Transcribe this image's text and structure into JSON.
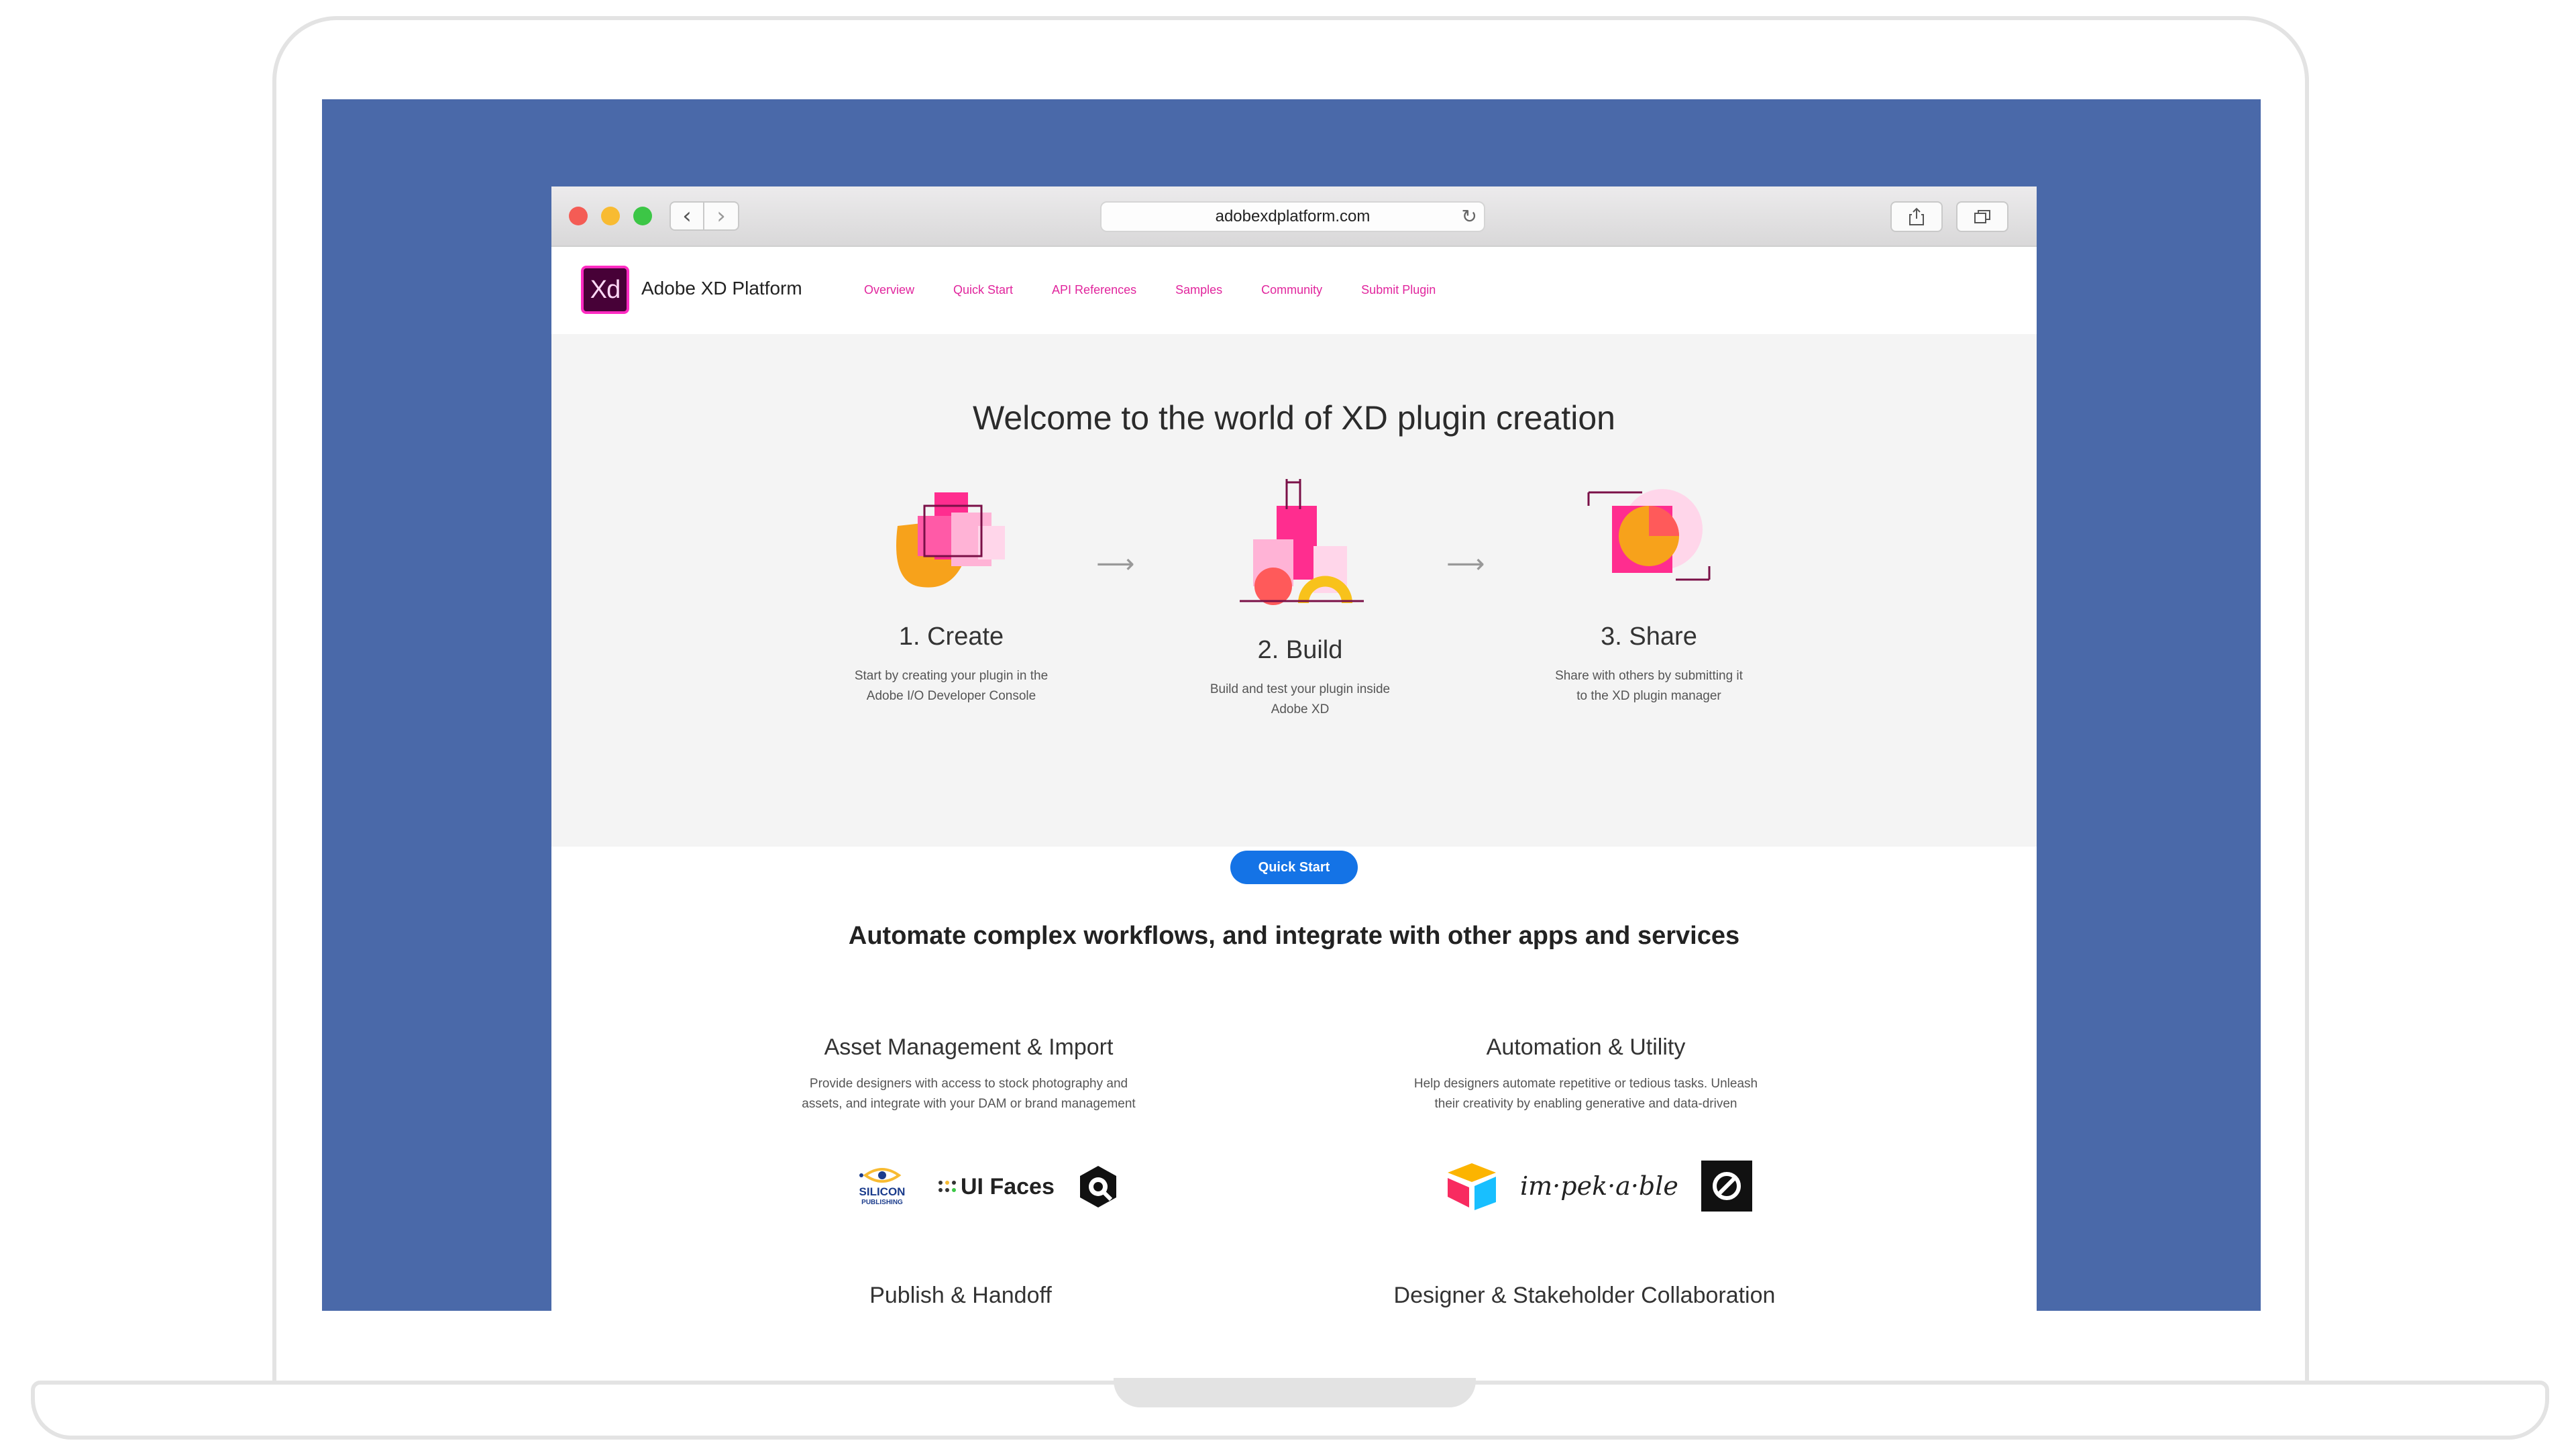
{
  "browser": {
    "url": "adobexdplatform.com"
  },
  "site": {
    "logo_text": "Xd",
    "title": "Adobe XD Platform",
    "nav": [
      "Overview",
      "Quick Start",
      "API References",
      "Samples",
      "Community",
      "Submit Plugin"
    ]
  },
  "hero": {
    "title": "Welcome to the world of XD plugin creation",
    "steps": [
      {
        "title": "1. Create",
        "desc_line1": "Start by creating your plugin in the",
        "desc_line2": "Adobe I/O Developer Console"
      },
      {
        "title": "2. Build",
        "desc_line1": "Build and test your plugin inside",
        "desc_line2": "Adobe XD"
      },
      {
        "title": "3. Share",
        "desc_line1": "Share with others by submitting it",
        "desc_line2": "to the XD plugin manager"
      }
    ],
    "cta": "Quick Start"
  },
  "workflows": {
    "title": "Automate complex workflows, and integrate with other apps and services",
    "categories": [
      {
        "title": "Asset Management & Import",
        "desc_line1": "Provide designers with access to stock photography and",
        "desc_line2": "assets, and integrate with your DAM or brand management"
      },
      {
        "title": "Automation & Utility",
        "desc_line1": "Help designers automate repetitive or tedious tasks. Unleash",
        "desc_line2": "their creativity by enabling generative and data-driven"
      },
      {
        "title": "Publish & Handoff"
      },
      {
        "title": "Designer & Stakeholder Collaboration"
      }
    ],
    "partner_logos": {
      "silicon_line1": "SILICON",
      "silicon_line2": "PUBLISHING",
      "uifaces": "UI Faces",
      "impekable": "im·pek·a·ble"
    }
  },
  "colors": {
    "screen_bg": "#4a69a9",
    "nav_link": "#e1259d",
    "cta": "#1473e6",
    "xd_purple": "#470137",
    "xd_pink": "#ff2bc2"
  }
}
